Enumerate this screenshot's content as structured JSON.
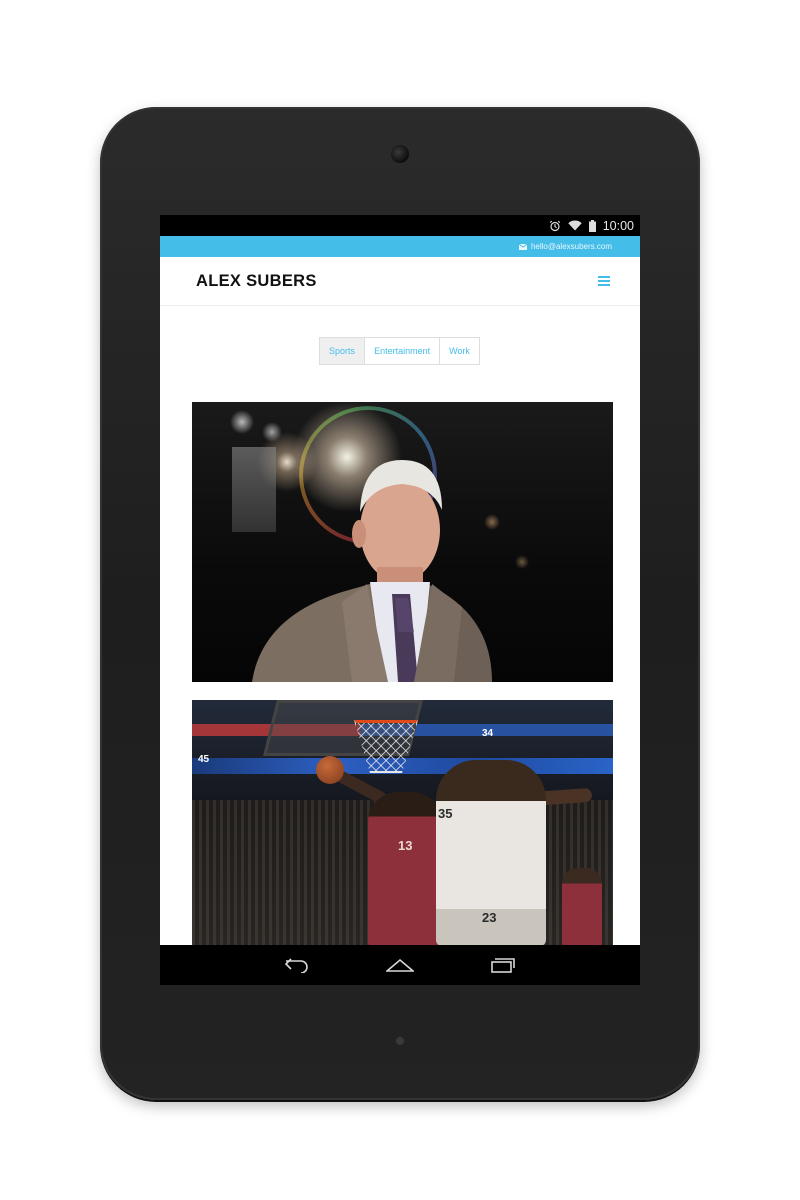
{
  "status_bar": {
    "time": "10:00",
    "icons": [
      "alarm-icon",
      "wifi-icon",
      "battery-icon"
    ]
  },
  "top_bar": {
    "email": "hello@alexsubers.com",
    "icon": "mail-icon"
  },
  "header": {
    "brand": "ALEX SUBERS",
    "menu_icon": "hamburger-menu-icon"
  },
  "filters": [
    {
      "label": "Sports",
      "active": true
    },
    {
      "label": "Entertainment",
      "active": false
    },
    {
      "label": "Work",
      "active": false
    }
  ],
  "gallery": {
    "photos": [
      {
        "subject": "coach-portrait"
      },
      {
        "subject": "basketball-dunk"
      }
    ],
    "jersey_numbers": [
      "35",
      "13",
      "23"
    ],
    "scoreboard": [
      "45",
      "34"
    ]
  },
  "nav_bar": {
    "buttons": [
      "back-icon",
      "home-icon",
      "recents-icon"
    ]
  },
  "colors": {
    "accent": "#44bde9",
    "device": "#222222",
    "text_dark": "#111111"
  }
}
